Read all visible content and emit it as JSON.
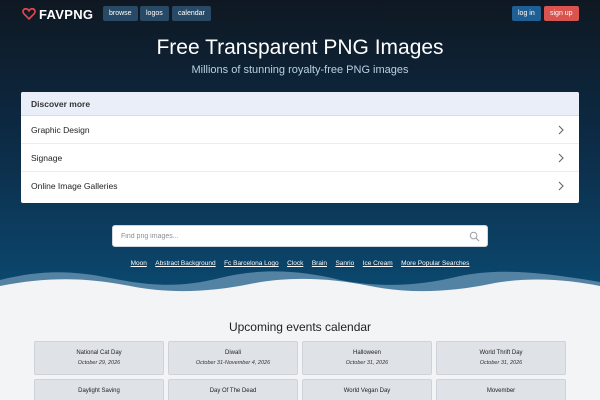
{
  "nav": {
    "logo": "FAVPNG",
    "links": [
      {
        "label": "browse"
      },
      {
        "label": "logos"
      },
      {
        "label": "calendar"
      }
    ],
    "login_label": "log in",
    "signup_label": "sign up"
  },
  "hero": {
    "title": "Free Transparent PNG Images",
    "subtitle": "Millions of stunning royalty-free PNG images"
  },
  "discover": {
    "header": "Discover more",
    "items": [
      {
        "label": "Graphic Design"
      },
      {
        "label": "Signage"
      },
      {
        "label": "Online Image Galleries"
      }
    ]
  },
  "search": {
    "placeholder": "Find png images...",
    "value": ""
  },
  "popular": {
    "links": [
      "Moon",
      "Abstract Background",
      "Fc Barcelona Logo",
      "Clock",
      "Brain",
      "Sanrio",
      "Ice Cream",
      "More Popular Searches"
    ]
  },
  "events": {
    "title": "Upcoming events calendar",
    "items": [
      {
        "name": "National Cat Day",
        "date": "October 29, 2026"
      },
      {
        "name": "Diwali",
        "date": "October 31-November 4, 2026"
      },
      {
        "name": "Halloween",
        "date": "October 31, 2026"
      },
      {
        "name": "World Thrift Day",
        "date": "October 31, 2026"
      },
      {
        "name": "Daylight Saving",
        "date": ""
      },
      {
        "name": "Day Of The Dead",
        "date": ""
      },
      {
        "name": "World Vegan Day",
        "date": ""
      },
      {
        "name": "Movember",
        "date": ""
      }
    ]
  },
  "colors": {
    "hero_top": "#0f1822",
    "hero_bottom": "#0b4a72",
    "signup": "#d9534f",
    "login": "#1f5f93",
    "logo_heart": "#e0454f"
  }
}
